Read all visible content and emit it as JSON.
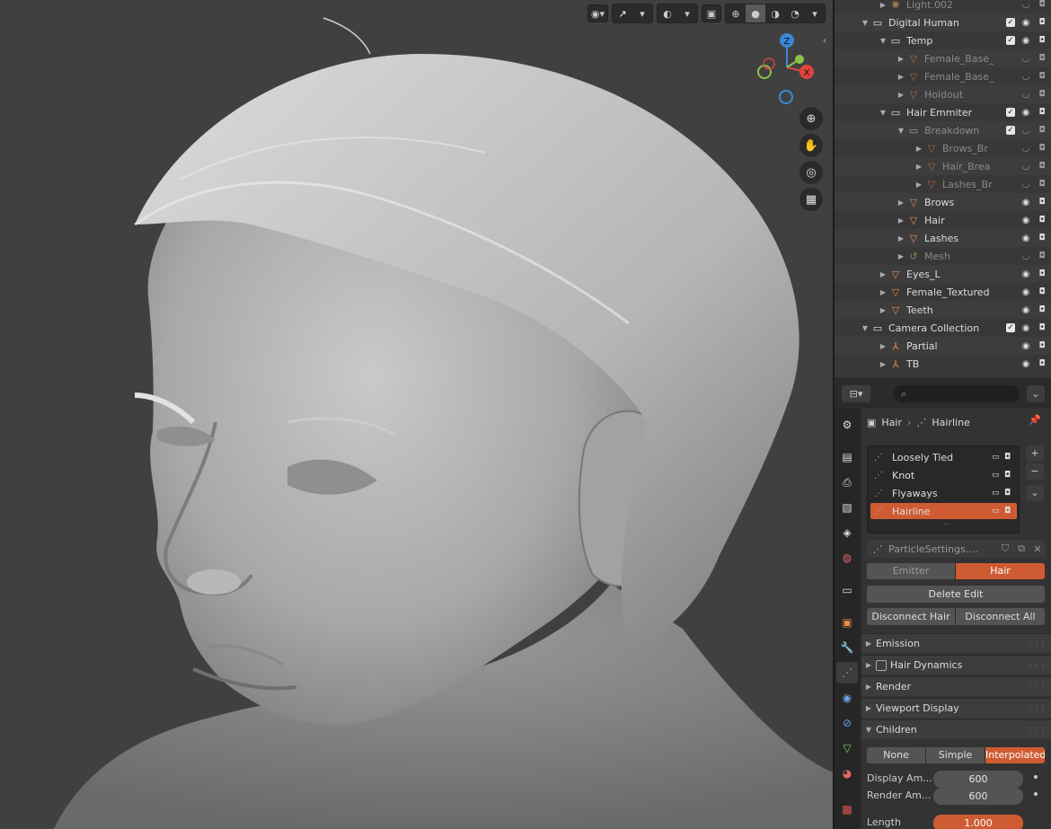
{
  "viewport": {
    "gizmo": {
      "z": "Z",
      "x": "X"
    },
    "colors": {
      "x_axis": "#e0443c",
      "y_axis": "#8ac44a",
      "z_axis": "#3c87d6",
      "accent": "#cf5b33"
    }
  },
  "outliner": {
    "rows": [
      {
        "name": "Light.002",
        "indent": 2,
        "dim": true,
        "icon": "light-icon"
      },
      {
        "name": "Digital Human",
        "indent": 1,
        "icon": "collection-icon",
        "check": true
      },
      {
        "name": "Temp",
        "indent": 2,
        "icon": "collection-icon",
        "check": true
      },
      {
        "name": "Female_Base_",
        "indent": 3,
        "dim": true,
        "icon": "mesh-icon"
      },
      {
        "name": "Female_Base_",
        "indent": 3,
        "dim": true,
        "icon": "mesh-icon"
      },
      {
        "name": "Holdout",
        "indent": 3,
        "dim": true,
        "icon": "mesh-icon"
      },
      {
        "name": "Hair Emmiter",
        "indent": 2,
        "icon": "collection-icon",
        "check": true
      },
      {
        "name": "Breakdown",
        "indent": 3,
        "dim": true,
        "icon": "collection-icon",
        "check": true
      },
      {
        "name": "Brows_Br",
        "indent": 4,
        "dim": true,
        "icon": "mesh-icon"
      },
      {
        "name": "Hair_Brea",
        "indent": 4,
        "dim": true,
        "icon": "mesh-icon"
      },
      {
        "name": "Lashes_Br",
        "indent": 4,
        "dim": true,
        "icon": "mesh-icon"
      },
      {
        "name": "Brows",
        "indent": 3,
        "icon": "mesh-icon"
      },
      {
        "name": "Hair",
        "indent": 3,
        "icon": "mesh-icon"
      },
      {
        "name": "Lashes",
        "indent": 3,
        "icon": "mesh-icon"
      },
      {
        "name": "Mesh",
        "indent": 3,
        "dim": true,
        "icon": "curve-icon"
      },
      {
        "name": "Eyes_L",
        "indent": 2,
        "icon": "mesh-icon"
      },
      {
        "name": "Female_Textured",
        "indent": 2,
        "icon": "mesh-icon"
      },
      {
        "name": "Teeth",
        "indent": 2,
        "icon": "mesh-icon"
      },
      {
        "name": "Camera Collection",
        "indent": 1,
        "icon": "collection-icon",
        "check": true
      },
      {
        "name": "Partial",
        "indent": 2,
        "icon": "empty-icon"
      },
      {
        "name": "TB",
        "indent": 2,
        "icon": "empty-icon"
      }
    ]
  },
  "properties": {
    "breadcrumb": {
      "object": "Hair",
      "system": "Hairline"
    },
    "particle_systems": [
      "Loosely Tied",
      "Knot",
      "Flyaways",
      "Hairline"
    ],
    "selected_system": "Hairline",
    "settings_name": "ParticleSettings....",
    "type_buttons": {
      "emitter": "Emitter",
      "hair": "Hair"
    },
    "delete_edit": "Delete Edit",
    "disconnect_hair": "Disconnect Hair",
    "disconnect_all": "Disconnect All",
    "panels": {
      "emission": "Emission",
      "hair_dynamics": "Hair Dynamics",
      "render": "Render",
      "viewport_display": "Viewport Display",
      "children": "Children"
    },
    "children_modes": {
      "none": "None",
      "simple": "Simple",
      "interpolated": "Interpolated"
    },
    "display_amount_label": "Display Am...",
    "display_amount": "600",
    "render_amount_label": "Render Am...",
    "render_amount": "600",
    "length_label": "Length",
    "length": "1.000"
  }
}
